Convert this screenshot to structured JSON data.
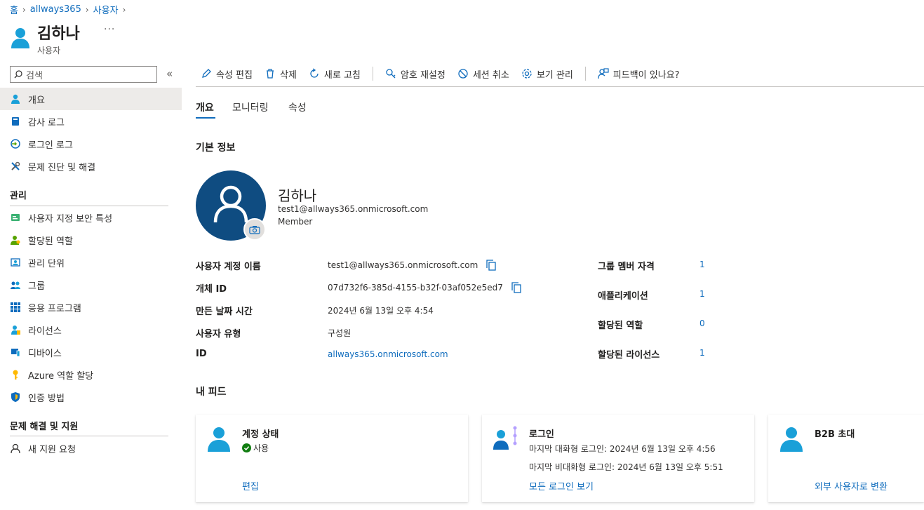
{
  "breadcrumb": [
    "홈",
    "allways365",
    "사용자"
  ],
  "header": {
    "title": "김하나",
    "subtitle": "사용자",
    "more": "···"
  },
  "sidebar": {
    "search_placeholder": "검색",
    "collapse": "«",
    "items": [
      {
        "label": "개요",
        "icon": "user-icon"
      },
      {
        "label": "감사 로그",
        "icon": "book-icon"
      },
      {
        "label": "로그인 로그",
        "icon": "signin-icon"
      },
      {
        "label": "문제 진단 및 해결",
        "icon": "wrench-icon"
      }
    ],
    "sections": [
      {
        "title": "관리",
        "items": [
          {
            "label": "사용자 지정 보안 특성",
            "icon": "attribute-icon"
          },
          {
            "label": "할당된 역할",
            "icon": "role-icon"
          },
          {
            "label": "관리 단위",
            "icon": "admin-unit-icon"
          },
          {
            "label": "그룹",
            "icon": "group-icon"
          },
          {
            "label": "응용 프로그램",
            "icon": "apps-icon"
          },
          {
            "label": "라이선스",
            "icon": "license-icon"
          },
          {
            "label": "디바이스",
            "icon": "device-icon"
          },
          {
            "label": "Azure 역할 할당",
            "icon": "key-icon"
          },
          {
            "label": "인증 방법",
            "icon": "shield-icon"
          }
        ]
      },
      {
        "title": "문제 해결 및 지원",
        "items": [
          {
            "label": "새 지원 요청",
            "icon": "support-icon"
          }
        ]
      }
    ]
  },
  "toolbar": {
    "edit": "속성 편집",
    "delete": "삭제",
    "refresh": "새로 고침",
    "reset_password": "암호 재설정",
    "revoke_sessions": "세션 취소",
    "manage_view": "보기 관리",
    "feedback": "피드백이 있나요?"
  },
  "tabs": [
    "개요",
    "모니터링",
    "속성"
  ],
  "basic_info_title": "기본 정보",
  "profile": {
    "name": "김하나",
    "email": "test1@allways365.onmicrosoft.com",
    "user_type": "Member"
  },
  "properties": [
    {
      "label": "사용자 계정 이름",
      "value": "test1@allways365.onmicrosoft.com",
      "copy": true,
      "link": false
    },
    {
      "label": "개체 ID",
      "value": "07d732f6-385d-4155-b32f-03af052e5ed7",
      "copy": true,
      "link": false
    },
    {
      "label": "만든 날짜 시간",
      "value": "2024년 6월 13일 오후 4:54",
      "copy": false,
      "link": false
    },
    {
      "label": "사용자 유형",
      "value": "구성원",
      "copy": false,
      "link": false
    },
    {
      "label": "ID",
      "value": "allways365.onmicrosoft.com",
      "copy": false,
      "link": true
    }
  ],
  "stats": [
    {
      "label": "그룹 멤버 자격",
      "value": "1"
    },
    {
      "label": "애플리케이션",
      "value": "1"
    },
    {
      "label": "할당된 역할",
      "value": "0"
    },
    {
      "label": "할당된 라이선스",
      "value": "1"
    }
  ],
  "feed_title": "내 피드",
  "cards": {
    "account": {
      "title": "계정 상태",
      "status": "사용",
      "link": "편집"
    },
    "signin": {
      "title": "로그인",
      "line1": "마지막 대화형 로그인: 2024년 6월 13일 오후 4:56",
      "line2": "마지막 비대화형 로그인: 2024년 6월 13일 오후 5:51",
      "link": "모든 로그인 보기"
    },
    "b2b": {
      "title": "B2B 초대",
      "link": "외부 사용자로 변환"
    }
  },
  "colors": {
    "accent": "#0f6cbd",
    "avatar": "#0f4c81",
    "success": "#107c10"
  }
}
